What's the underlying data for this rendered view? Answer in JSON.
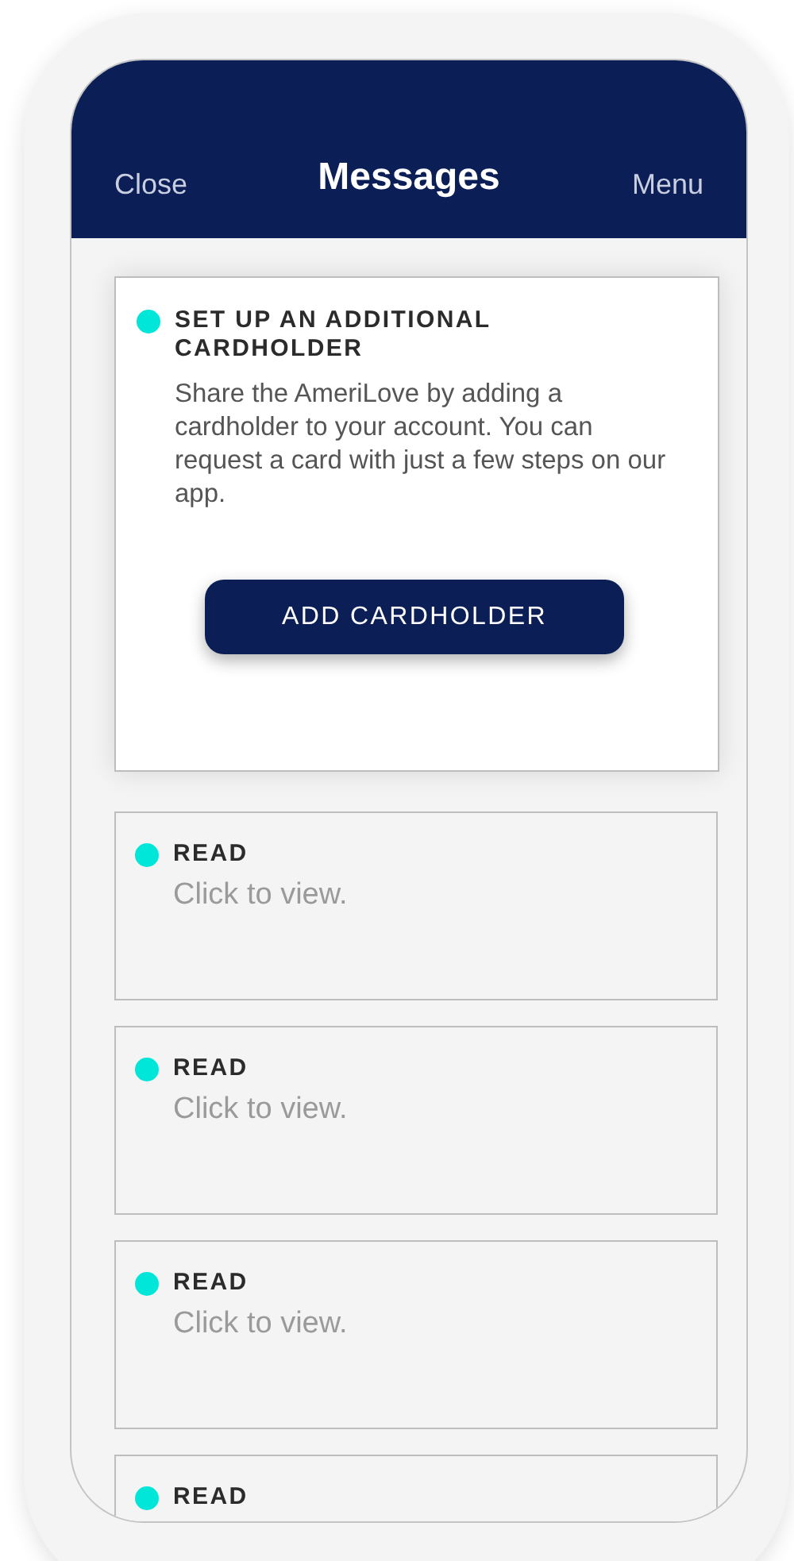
{
  "header": {
    "close": "Close",
    "title": "Messages",
    "menu": "Menu"
  },
  "messages": [
    {
      "kind": "action",
      "title": "SET UP AN ADDITIONAL CARDHOLDER",
      "body": "Share the AmeriLove by adding a cardholder to your account. You can request a card with just a few steps on our app.",
      "button": "ADD CARDHOLDER"
    },
    {
      "kind": "plain",
      "title": "READ",
      "body": "Click to view."
    },
    {
      "kind": "plain",
      "title": "READ",
      "body": "Click to view."
    },
    {
      "kind": "plain",
      "title": "READ",
      "body": "Click to view."
    },
    {
      "kind": "plain",
      "title": "READ"
    }
  ]
}
